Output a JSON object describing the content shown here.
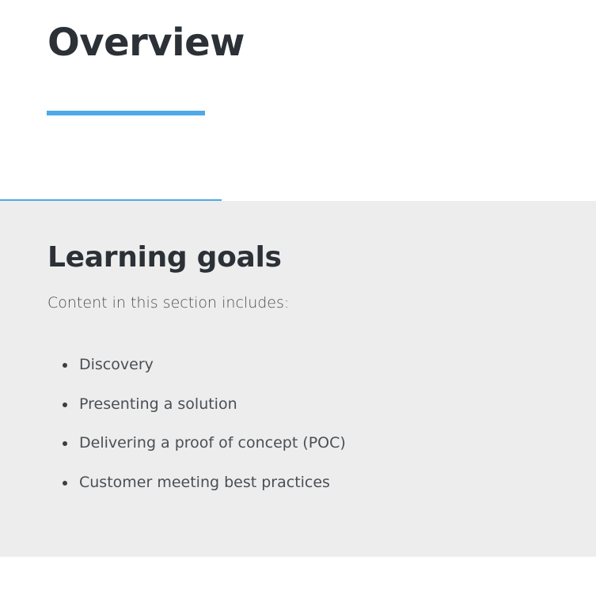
{
  "header": {
    "title": "Overview"
  },
  "learning_goals": {
    "heading": "Learning goals",
    "intro": "Content in this section includes:",
    "items": [
      {
        "label": "Discovery"
      },
      {
        "label": "Presenting a solution"
      },
      {
        "label": "Delivering a proof of concept (POC)"
      },
      {
        "label": "Customer meeting best practices"
      }
    ]
  },
  "colors": {
    "accent": "#4fa8e8",
    "heading_text": "#2b3136",
    "body_text": "#4a4f54",
    "section_background": "#ededed"
  }
}
